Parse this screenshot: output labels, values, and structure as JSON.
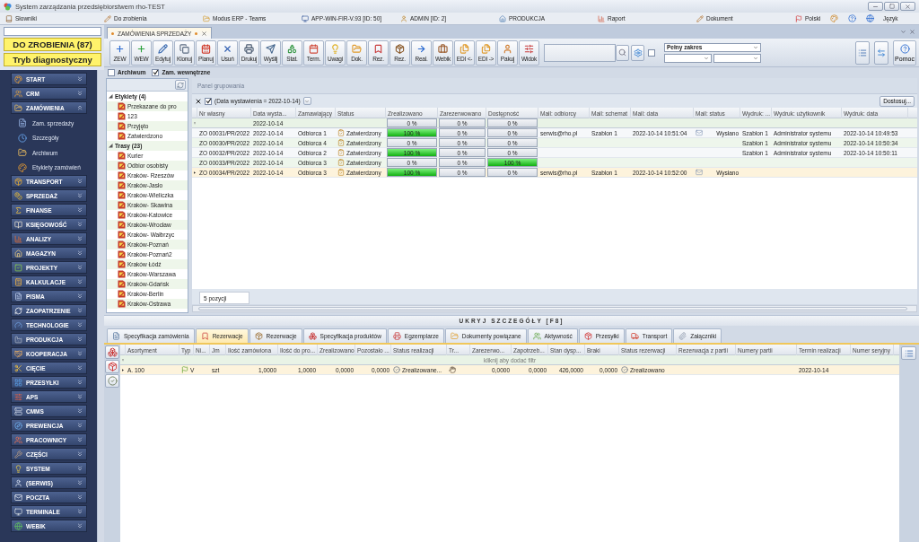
{
  "window": {
    "title": "System zarządzania przedsiębiorstwem rho-TEST"
  },
  "info_bar": {
    "items": [
      "Słowniki",
      "Do zrobienia",
      "Modus ERP - Teams",
      "APP-WIN-FIR-V.93 [ID: 50]",
      "ADMIN [ID: 2]",
      "PRODUKCJA",
      "Raport",
      "Dokument",
      "Polski"
    ],
    "language": "Język"
  },
  "sidebar": {
    "todo": "DO ZROBIENIA (87)",
    "mode": "Tryb diagnostyczny",
    "items": [
      {
        "label": "START",
        "expanded": false
      },
      {
        "label": "CRM",
        "expanded": false
      },
      {
        "label": "ZAMÓWIENIA",
        "expanded": true,
        "children": [
          "Zam. sprzedaży",
          "Szczegóły",
          "Archiwum",
          "Etykiety zamówień"
        ]
      },
      {
        "label": "TRANSPORT",
        "expanded": false
      },
      {
        "label": "SPRZEDAŻ",
        "expanded": false
      },
      {
        "label": "FINANSE",
        "expanded": false
      },
      {
        "label": "KSIĘGOWOŚĆ",
        "expanded": false
      },
      {
        "label": "ANALIZY",
        "expanded": false
      },
      {
        "label": "MAGAZYN",
        "expanded": false
      },
      {
        "label": "PROJEKTY",
        "expanded": false
      },
      {
        "label": "KALKULACJE",
        "expanded": false
      },
      {
        "label": "PISMA",
        "expanded": false
      },
      {
        "label": "ZAOPATRZENIE",
        "expanded": false
      },
      {
        "label": "TECHNOLOGIE",
        "expanded": false
      },
      {
        "label": "PRODUKCJA",
        "expanded": false
      },
      {
        "label": "KOOPERACJA",
        "expanded": false
      },
      {
        "label": "CIĘCIE",
        "expanded": false
      },
      {
        "label": "PRZESYŁKI",
        "expanded": false
      },
      {
        "label": "APS",
        "expanded": false
      },
      {
        "label": "CMMS",
        "expanded": false
      },
      {
        "label": "PREWENCJA",
        "expanded": false
      },
      {
        "label": "PRACOWNICY",
        "expanded": false
      },
      {
        "label": "CZĘŚCI",
        "expanded": false
      },
      {
        "label": "SYSTEM",
        "expanded": false
      },
      {
        "label": "(SERWIS)",
        "expanded": false
      },
      {
        "label": "POCZTA",
        "expanded": false
      },
      {
        "label": "TERMINALE",
        "expanded": false
      },
      {
        "label": "WEBIK",
        "expanded": false
      }
    ]
  },
  "document_tabs": [
    {
      "label": "ZAMÓWIENIA SPRZEDAŻY",
      "selected": true
    }
  ],
  "toolbar": {
    "buttons": [
      "ZEW",
      "WEW",
      "Edytuj",
      "Klonuj",
      "Planuj",
      "Usuń",
      "Drukuj",
      "Wyślij",
      "Stat.",
      "Term.",
      "Uwagi",
      "Dok.",
      "Rez.",
      "Rez.",
      "Real.",
      "Webik",
      "EDI <-",
      "EDI ->",
      "Pakuj",
      "Widok"
    ],
    "range": "Pełny zakres",
    "help": "Pomoc",
    "checked": false
  },
  "options": [
    {
      "label": "Archiwum",
      "checked": false
    },
    {
      "label": "Zam. wewnętrzne",
      "checked": true
    }
  ],
  "tree": [
    {
      "label": "Etykiety (4)",
      "expanded": true,
      "children": [
        "Przekazane do pro",
        "123",
        "Przyjęto",
        "Zatwierdzono"
      ]
    },
    {
      "label": "Trasy (23)",
      "expanded": true,
      "children": [
        "Kurier",
        "Odbior osobisty",
        "Kraków- Rzeszów",
        "Kraków-Jasło",
        "Kraków-Wieliczka",
        "Kraków- Skawina",
        "Kraków-Katowice",
        "Kraków-Wrocław",
        "Kraków- Wałbrzyc",
        "Kraków-Poznań",
        "Kraków-Poznań2",
        "Kraków Łódź",
        "Kraków-Warszawa",
        "Kraków-Gdańsk",
        "Kraków-Berlin",
        "Kraków-Ostrawa"
      ]
    }
  ],
  "grid": {
    "group_panel": "Panel grupowania",
    "filter": {
      "enabled": true,
      "text": "(Data wystawienia = 2022-10-14)"
    },
    "customize": "Dostosuj...",
    "columns": [
      "Nr własny",
      "Data wysta...",
      "Zamawiający",
      "Status",
      "Zrealizowano",
      "Zarezerwowano",
      "Dostępność",
      "Mail: odbiorcy",
      "Mail: schemat",
      "Mail: data",
      "Mail: status",
      "Wydruk: ...",
      "Wydruk: użytkownik",
      "Wydruk: data"
    ],
    "filter_row": {
      "date": "2022-10-14",
      "progress": [
        {
          "level": 0,
          "reading": "0 %"
        },
        {
          "level": 0,
          "reading": "0 %"
        },
        {
          "level": 0,
          "reading": "0 %"
        }
      ]
    },
    "rows": [
      {
        "selected": false,
        "cells": [
          "ZO 00031/PR/2022",
          "2022-10-14",
          "Odbiorca 1",
          "Zatwierdzony",
          {
            "level": 1,
            "reading": "100 %"
          },
          {
            "level": 0,
            "reading": "0 %"
          },
          {
            "level": 0,
            "reading": "0 %"
          },
          "serwis@rho.pl",
          "Szablon 1",
          "2022-10-14 10:51:04",
          "Wysłano",
          "Szablon 1",
          "Administrator systemu",
          "2022-10-14 10:49:53"
        ]
      },
      {
        "selected": false,
        "cells": [
          "ZO 00030/PR/2022",
          "2022-10-14",
          "Odbiorca 4",
          "Zatwierdzony",
          {
            "level": 0,
            "reading": "0 %"
          },
          {
            "level": 0,
            "reading": "0 %"
          },
          {
            "level": 0,
            "reading": "0 %"
          },
          null,
          null,
          null,
          null,
          "Szablon 1",
          "Administrator systemu",
          "2022-10-14 10:50:34"
        ]
      },
      {
        "selected": false,
        "cells": [
          "ZO 00032/PR/2022",
          "2022-10-14",
          "Odbiorca 2",
          "Zatwierdzony",
          {
            "level": 1,
            "reading": "100 %"
          },
          {
            "level": 0,
            "reading": "0 %"
          },
          {
            "level": 0,
            "reading": "0 %"
          },
          null,
          null,
          null,
          null,
          "Szablon 1",
          "Administrator systemu",
          "2022-10-14 10:50:11"
        ]
      },
      {
        "selected": false,
        "cells": [
          "ZO 00033/PR/2022",
          "2022-10-14",
          "Odbiorca 3",
          "Zatwierdzony",
          {
            "level": 0,
            "reading": "0 %"
          },
          {
            "level": 0,
            "reading": "0 %"
          },
          {
            "level": 1,
            "reading": "100 %"
          },
          null,
          null,
          null,
          null,
          null,
          null,
          null
        ]
      },
      {
        "selected": true,
        "cells": [
          "ZO 00034/PR/2022",
          "2022-10-14",
          "Odbiorca 3",
          "Zatwierdzony",
          {
            "level": 1,
            "reading": "100 %"
          },
          {
            "level": 0,
            "reading": "0 %"
          },
          {
            "level": 0,
            "reading": "0 %"
          },
          "serwis@rho.pl",
          "Szablon 1",
          "2022-10-14 10:52:00",
          "Wysłano",
          null,
          null,
          null
        ]
      }
    ],
    "footer": "5 pozycji"
  },
  "details_toggle": "UKRYJ SZCZEGÓŁY [F8]",
  "detail_tabs": [
    {
      "label": "Specyfikacja zamówienia",
      "selected": false
    },
    {
      "label": "Rezerwacje",
      "selected": true
    },
    {
      "label": "Rezerwacje",
      "selected": false
    },
    {
      "label": "Specyfikacja produktów",
      "selected": false
    },
    {
      "label": "Egzemplarze",
      "selected": false
    },
    {
      "label": "Dokumenty powiązane",
      "selected": false
    },
    {
      "label": "Aktywność",
      "selected": false
    },
    {
      "label": "Przesyłki",
      "selected": false
    },
    {
      "label": "Transport",
      "selected": false
    },
    {
      "label": "Załączniki",
      "selected": false
    }
  ],
  "detail_grid": {
    "columns": [
      "Asortyment",
      "Typ",
      "Ni...",
      "Jm",
      "Ilość zamówiona",
      "Ilość do pro...",
      "Zrealizowano",
      "Pozostało ...",
      "Status realizacji",
      "Tr...",
      "Zarezerwo...",
      "Zapotrzeb...",
      "Stan dysp...",
      "Braki",
      "Status rezerwacji",
      "Rezerwacja z partii",
      "Numery partii",
      "Termin realizacji",
      "Numer seryjny"
    ],
    "filter_hint": "kliknij aby dodać filtr",
    "rows": [
      {
        "selected": true,
        "cells": [
          "A. 100",
          "V",
          null,
          "szt",
          "1,0000",
          "1,0000",
          "0,0000",
          "0,0000",
          "Zrealizowane...",
          null,
          "0,0000",
          "0,0000",
          "426,0000",
          "0,0000",
          "Zrealizowano",
          null,
          null,
          "2022-10-14",
          null
        ]
      }
    ]
  }
}
